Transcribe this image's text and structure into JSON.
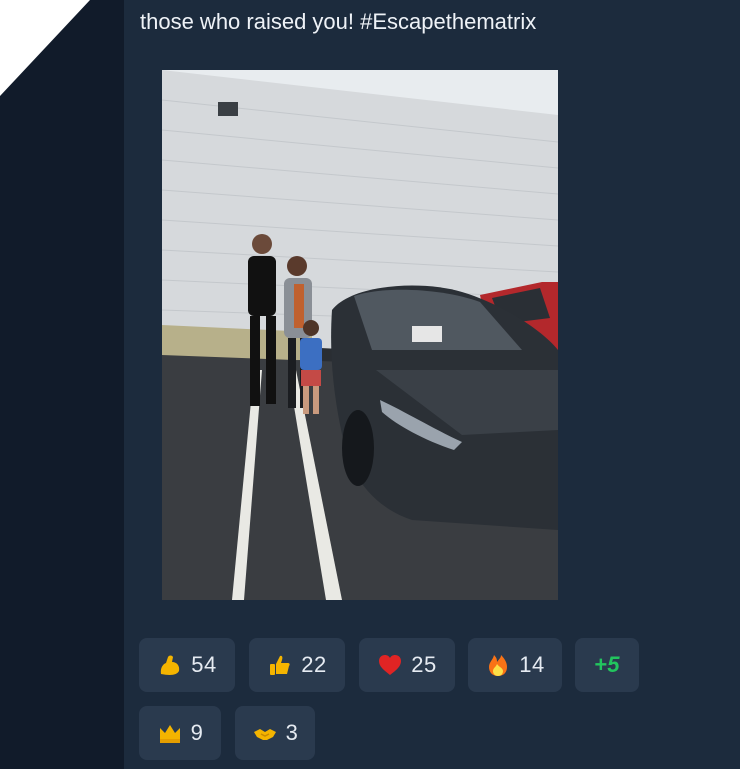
{
  "post": {
    "text": "those who raised you! #Escapethematrix",
    "image_alt": "Family photo with a dark grey Tesla in a parking lot"
  },
  "reactions": [
    {
      "icon": "flexed-biceps-icon",
      "count": "54"
    },
    {
      "icon": "thumbs-up-icon",
      "count": "22"
    },
    {
      "icon": "heart-icon",
      "count": "25"
    },
    {
      "icon": "fire-icon",
      "count": "14"
    },
    {
      "icon": "more-reactions",
      "count": "+5"
    },
    {
      "icon": "crown-icon",
      "count": "9"
    },
    {
      "icon": "handshake-icon",
      "count": "3"
    }
  ],
  "colors": {
    "backdrop": "#111b2a",
    "card": "#1c2b3d",
    "chip": "#2a3a4e",
    "more_accent": "#22c55e"
  }
}
